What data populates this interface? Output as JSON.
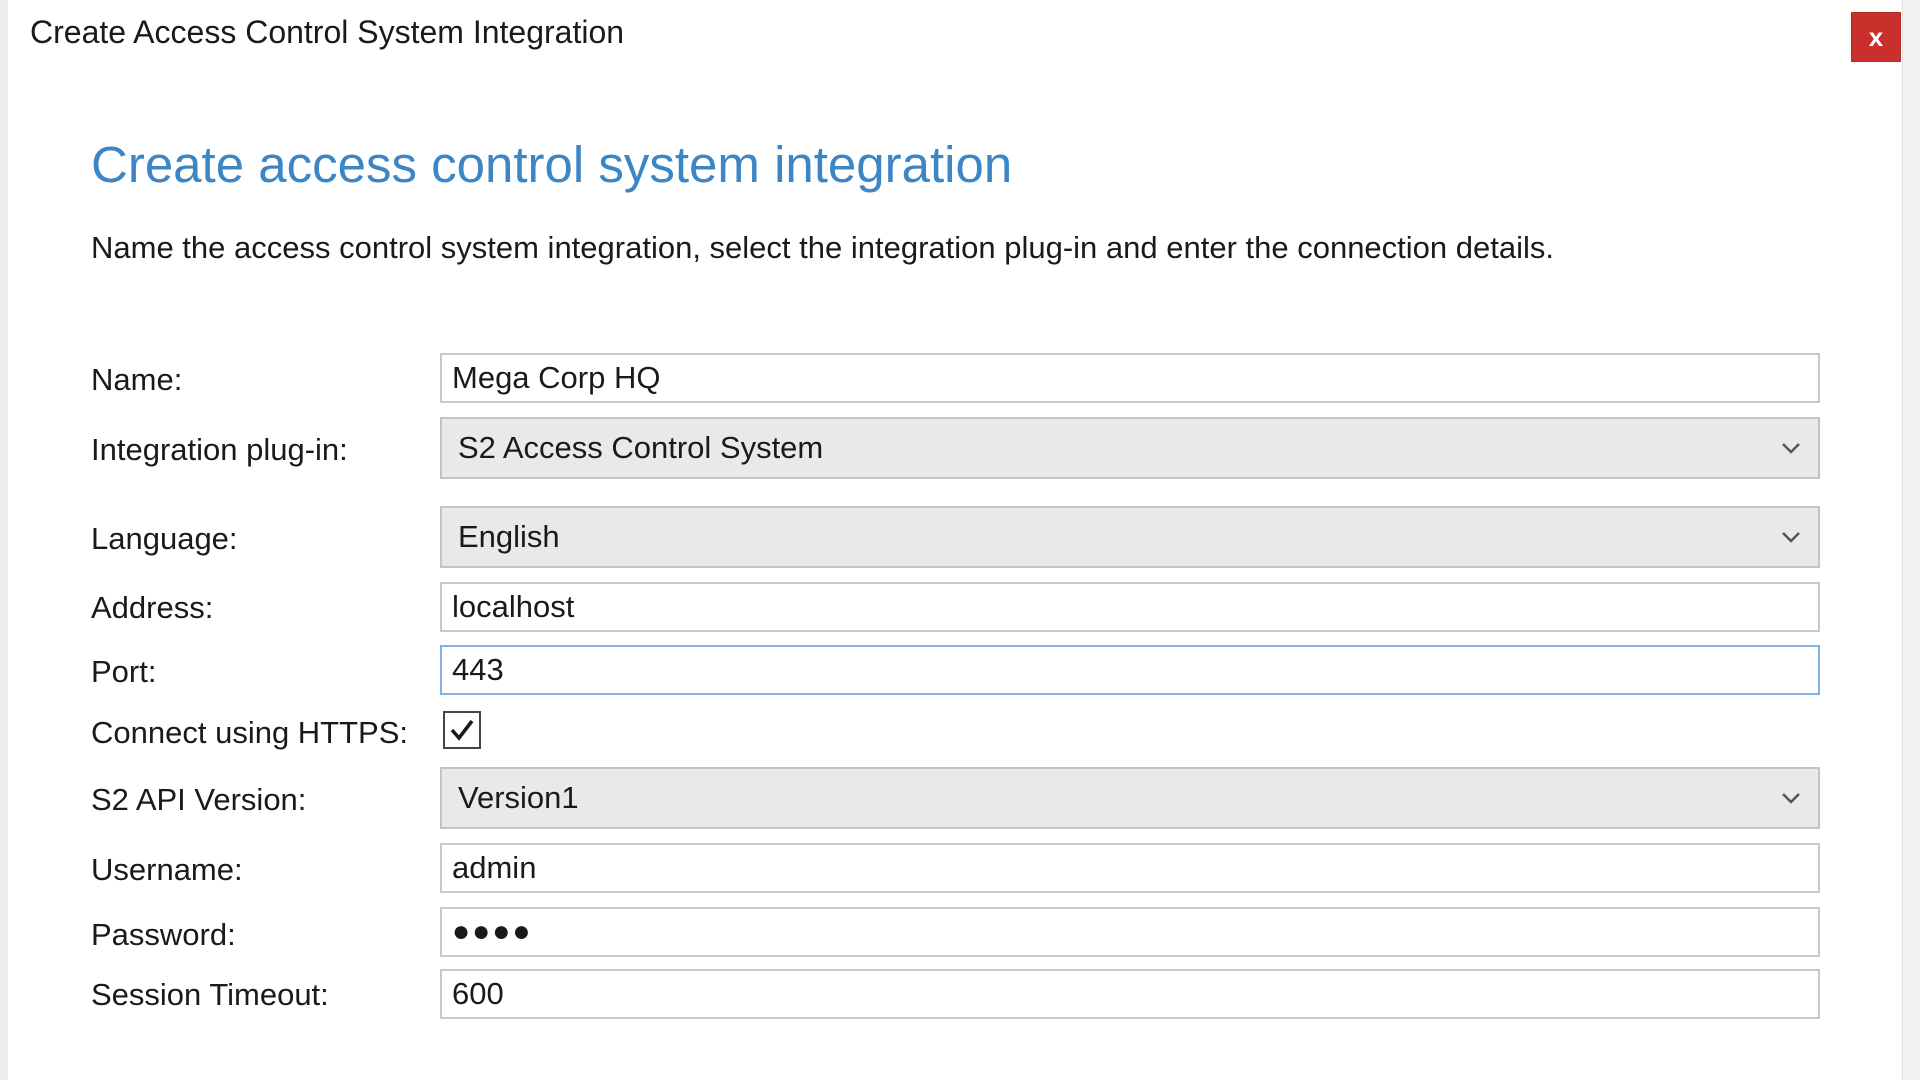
{
  "window": {
    "title": "Create Access Control System Integration",
    "close_label": "x"
  },
  "page": {
    "heading": "Create access control system integration",
    "description": "Name the access control system integration, select the integration plug-in and enter the connection details."
  },
  "form": {
    "name": {
      "label": "Name:",
      "value": "Mega Corp HQ"
    },
    "plugin": {
      "label": "Integration plug-in:",
      "value": "S2 Access Control System"
    },
    "language": {
      "label": "Language:",
      "value": "English"
    },
    "address": {
      "label": "Address:",
      "value": "localhost"
    },
    "port": {
      "label": "Port:",
      "value": "443"
    },
    "https": {
      "label": "Connect using HTTPS:",
      "checked": true
    },
    "api_version": {
      "label": "S2 API Version:",
      "value": "Version1"
    },
    "username": {
      "label": "Username:",
      "value": "admin"
    },
    "password": {
      "label": "Password:",
      "value": "●●●●"
    },
    "session_timeout": {
      "label": "Session Timeout:",
      "value": "600"
    }
  },
  "colors": {
    "heading": "#3d86c6",
    "close_button": "#c9302c",
    "focus_border": "#7fb2e5"
  },
  "icons": {
    "close": "close-icon",
    "dropdown": "chevron-down-icon",
    "checkbox": "checkmark-icon"
  }
}
